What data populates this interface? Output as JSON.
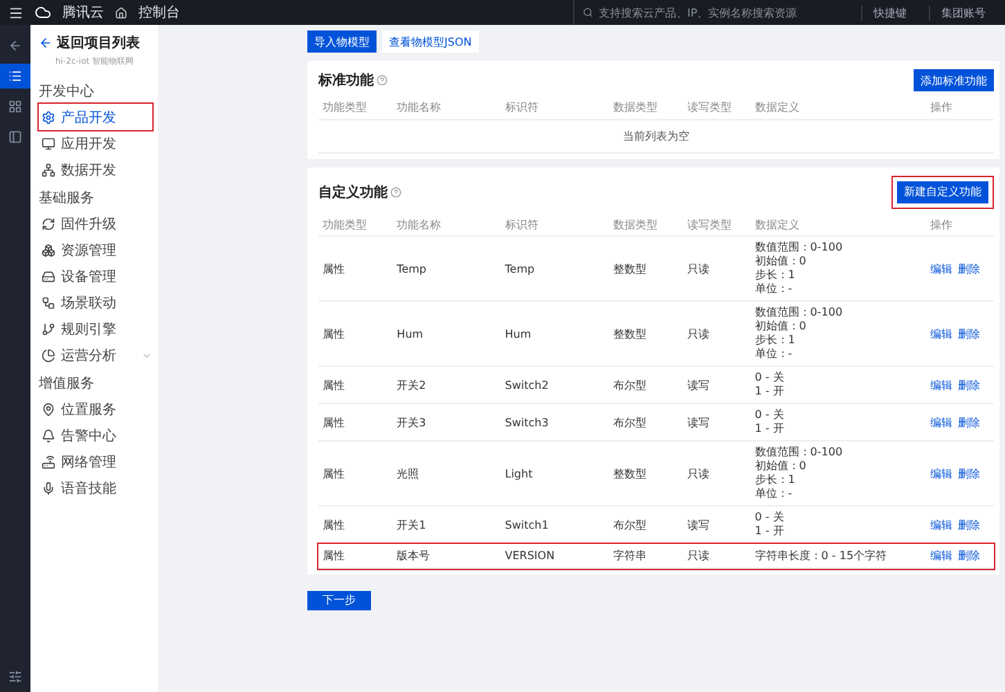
{
  "topbar": {
    "brand": "腾讯云",
    "console": "控制台",
    "search": {
      "placeholder": "支持搜索云产品、IP、实例名称搜索资源"
    },
    "links": [
      "快捷键",
      "集团账号"
    ]
  },
  "rail": [
    {
      "selected": false
    },
    {
      "selected": true
    },
    {
      "selected": false
    },
    {
      "selected": false
    }
  ],
  "sidebar": {
    "back": "返回项目列表",
    "subtitle": "hi-2c-iot 智能物联网",
    "groups": [
      {
        "title": "开发中心",
        "items": [
          {
            "label": "产品开发",
            "selected": true,
            "highlighted": true
          },
          {
            "label": "应用开发",
            "selected": false,
            "highlighted": false
          },
          {
            "label": "数据开发",
            "selected": false,
            "highlighted": false
          }
        ]
      },
      {
        "title": "基础服务",
        "items": [
          {
            "label": "固件升级",
            "selected": false,
            "highlighted": false
          },
          {
            "label": "资源管理",
            "selected": false,
            "highlighted": false
          },
          {
            "label": "设备管理",
            "selected": false,
            "highlighted": false
          },
          {
            "label": "场景联动",
            "selected": false,
            "highlighted": false
          },
          {
            "label": "规则引擎",
            "selected": false,
            "highlighted": false
          },
          {
            "label": "运营分析",
            "selected": false,
            "highlighted": false,
            "expandable": true
          }
        ]
      },
      {
        "title": "增值服务",
        "items": [
          {
            "label": "位置服务",
            "selected": false,
            "highlighted": false
          },
          {
            "label": "告警中心",
            "selected": false,
            "highlighted": false
          },
          {
            "label": "网络管理",
            "selected": false,
            "highlighted": false
          },
          {
            "label": "语音技能",
            "selected": false,
            "highlighted": false
          }
        ]
      }
    ]
  },
  "toolbar": [
    {
      "label": "导入物模型",
      "kind": "primary"
    },
    {
      "label": "查看物模型JSON",
      "kind": "secondary"
    }
  ],
  "standard": {
    "columns": [
      "功能类型",
      "功能名称",
      "标识符",
      "数据类型",
      "读写类型",
      "数据定义",
      "操作"
    ],
    "title": "标准功能",
    "button": {
      "label": "添加标准功能"
    },
    "empty": "当前列表为空"
  },
  "custom": {
    "columns": [
      "功能类型",
      "功能名称",
      "标识符",
      "数据类型",
      "读写类型",
      "数据定义",
      "操作"
    ],
    "title": "自定义功能",
    "button": {
      "label": "新建自定义功能",
      "highlighted": true
    },
    "rows": [
      {
        "type": "属性",
        "name": "Temp",
        "id": "Temp",
        "dtype": "整数型",
        "rw": "只读",
        "definition": [
          "数值范围：0-100",
          "初始值：0",
          "步长：1",
          "单位：-"
        ],
        "actions": [
          "编辑",
          "删除"
        ],
        "highlighted": false
      },
      {
        "type": "属性",
        "name": "Hum",
        "id": "Hum",
        "dtype": "整数型",
        "rw": "只读",
        "definition": [
          "数值范围：0-100",
          "初始值：0",
          "步长：1",
          "单位：-"
        ],
        "actions": [
          "编辑",
          "删除"
        ],
        "highlighted": false
      },
      {
        "type": "属性",
        "name": "开关2",
        "id": "Switch2",
        "dtype": "布尔型",
        "rw": "读写",
        "definition": [
          "0 - 关",
          "1 - 开"
        ],
        "actions": [
          "编辑",
          "删除"
        ],
        "highlighted": false
      },
      {
        "type": "属性",
        "name": "开关3",
        "id": "Switch3",
        "dtype": "布尔型",
        "rw": "读写",
        "definition": [
          "0 - 关",
          "1 - 开"
        ],
        "actions": [
          "编辑",
          "删除"
        ],
        "highlighted": false
      },
      {
        "type": "属性",
        "name": "光照",
        "id": "Light",
        "dtype": "整数型",
        "rw": "只读",
        "definition": [
          "数值范围：0-100",
          "初始值：0",
          "步长：1",
          "单位：-"
        ],
        "actions": [
          "编辑",
          "删除"
        ],
        "highlighted": false
      },
      {
        "type": "属性",
        "name": "开关1",
        "id": "Switch1",
        "dtype": "布尔型",
        "rw": "读写",
        "definition": [
          "0 - 关",
          "1 - 开"
        ],
        "actions": [
          "编辑",
          "删除"
        ],
        "highlighted": false
      },
      {
        "type": "属性",
        "name": "版本号",
        "id": "VERSION",
        "dtype": "字符串",
        "rw": "只读",
        "definition": [
          "字符串长度：0 - 15个字符"
        ],
        "actions": [
          "编辑",
          "删除"
        ],
        "highlighted": true
      }
    ]
  },
  "next": "下一步"
}
